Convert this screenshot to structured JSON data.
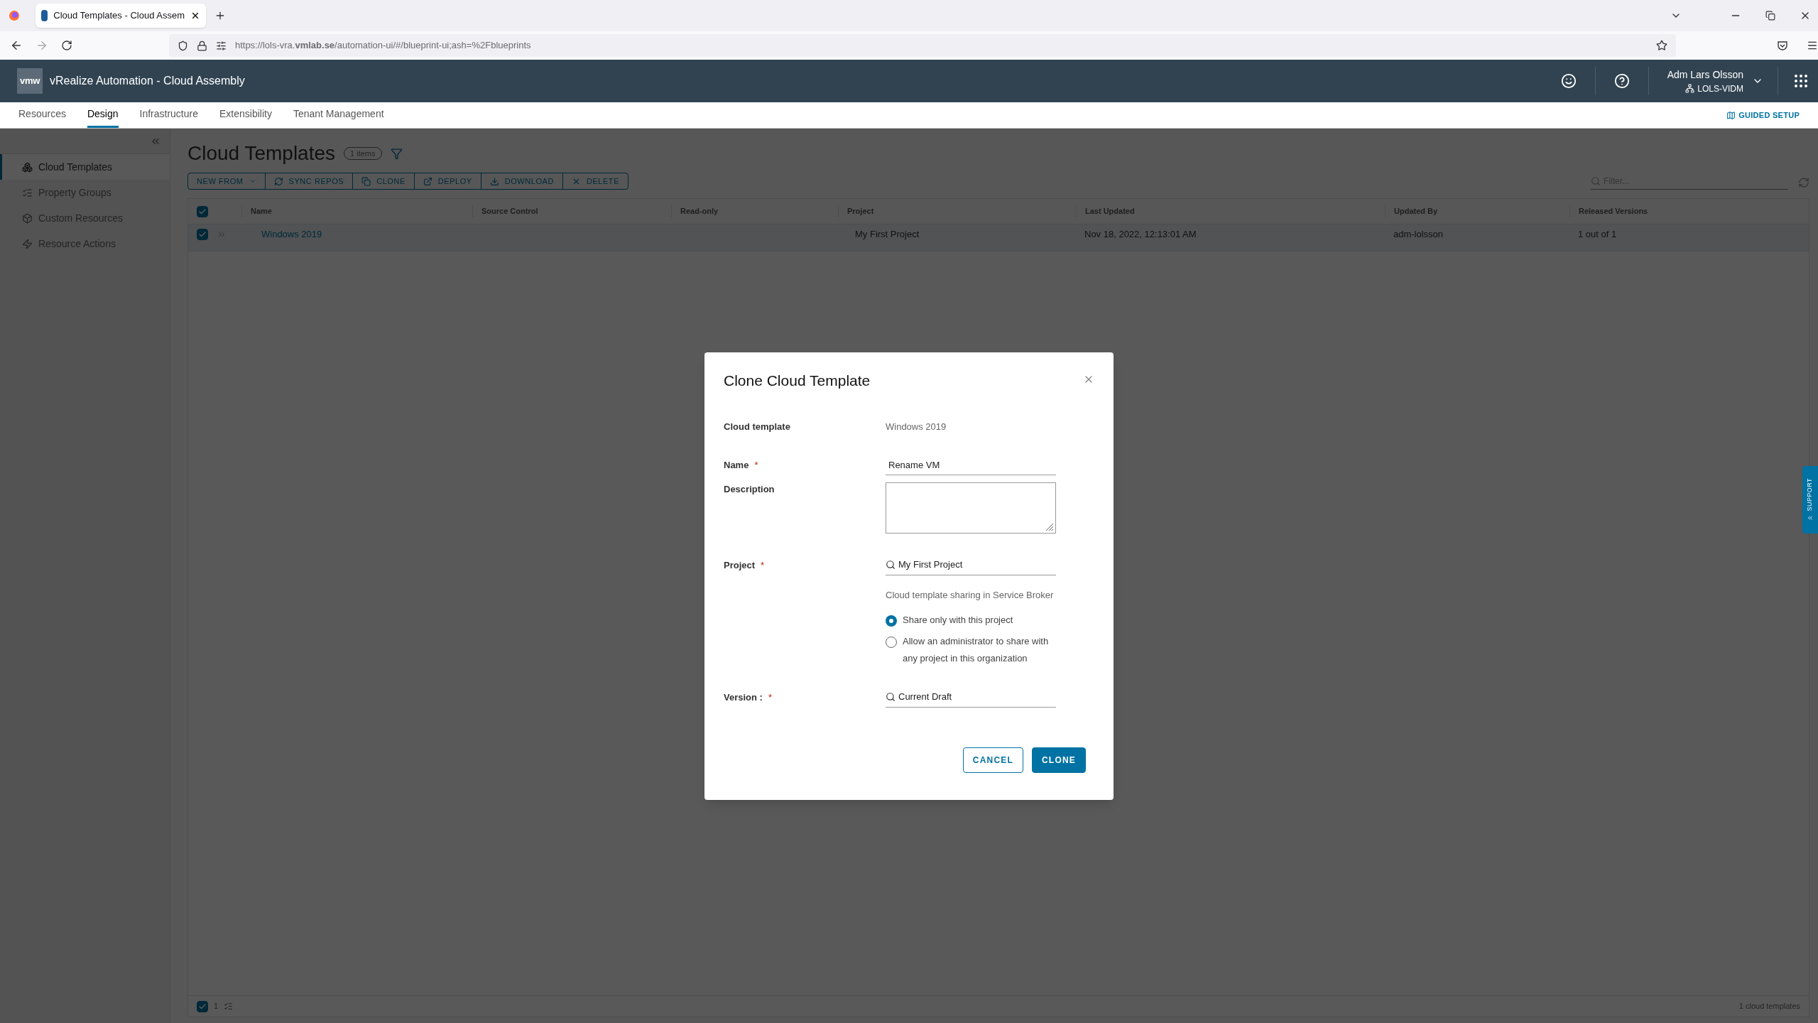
{
  "browser": {
    "tab_title": "Cloud Templates - Cloud Assem",
    "url": "https://lols-vra.**vmlab.se**/automation-ui/#/blueprint-ui;ash=%2Fblueprints"
  },
  "header": {
    "logo": "vmw",
    "title": "vRealize Automation - Cloud Assembly",
    "user": "Adm Lars Olsson",
    "org": "LOLS-VIDM"
  },
  "nav": {
    "tabs": [
      {
        "label": "Resources",
        "selected": false
      },
      {
        "label": "Design",
        "selected": true
      },
      {
        "label": "Infrastructure",
        "selected": false
      },
      {
        "label": "Extensibility",
        "selected": false
      },
      {
        "label": "Tenant Management",
        "selected": false
      }
    ],
    "guided_setup": "GUIDED SETUP"
  },
  "sidebar": {
    "items": [
      {
        "label": "Cloud Templates",
        "selected": true
      },
      {
        "label": "Property Groups",
        "selected": false
      },
      {
        "label": "Custom Resources",
        "selected": false
      },
      {
        "label": "Resource Actions",
        "selected": false
      }
    ]
  },
  "page": {
    "title": "Cloud Templates",
    "count": "1 items",
    "toolbar": [
      "NEW FROM",
      "SYNC REPOS",
      "CLONE",
      "DEPLOY",
      "DOWNLOAD",
      "DELETE"
    ],
    "filter": {
      "placeholder": "Filter..."
    }
  },
  "table": {
    "all_checked": true,
    "columns": [
      "Name",
      "Source Control",
      "Read-only",
      "Project",
      "Last Updated",
      "Updated By",
      "Released Versions"
    ],
    "rows": [
      {
        "checked": true,
        "name": "Windows 2019",
        "project": "My First Project",
        "last_updated": "Nov 18, 2022, 12:13:01 AM",
        "updated_by": "adm-lolsson",
        "released_versions": "1 out of 1"
      }
    ],
    "footer": {
      "checked": true,
      "selected_count": "1",
      "total": "1 cloud templates"
    }
  },
  "dialog": {
    "title": "Clone Cloud Template",
    "fields": [
      {
        "kind": "static",
        "label": "Cloud template",
        "value": "Windows 2019"
      },
      {
        "kind": "text",
        "label": "Name",
        "required_mark": "*",
        "value": "Rename VM"
      },
      {
        "kind": "textarea",
        "label": "Description"
      },
      {
        "kind": "search",
        "label": "Project",
        "required_mark": "*",
        "value": "My First Project"
      },
      {
        "kind": "note",
        "text": "Cloud template sharing in Service Broker"
      },
      {
        "kind": "radio",
        "options": [
          {
            "label": "Share only with this project",
            "selected": true
          },
          {
            "label": "Allow an administrator to share with any project in this organization",
            "selected": false
          }
        ]
      },
      {
        "kind": "search",
        "label": "Version :",
        "required_mark": "*",
        "value": "Current Draft"
      }
    ],
    "buttons": [
      {
        "label": "CANCEL",
        "kind": "secondary"
      },
      {
        "label": "CLONE",
        "kind": "primary"
      }
    ]
  },
  "support_tab": "SUPPORT"
}
